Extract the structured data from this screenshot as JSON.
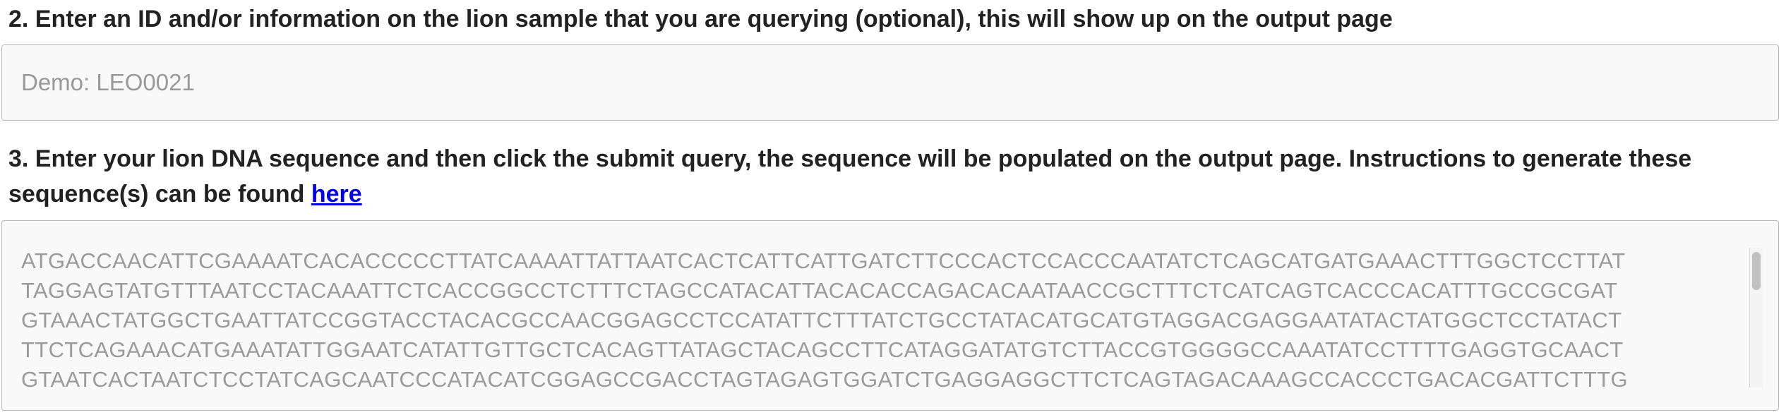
{
  "step2": {
    "label": "2. Enter an ID and/or information on the lion sample that you are querying (optional), this will show up on the output page",
    "input_placeholder": "Demo: LEO0021",
    "input_value": ""
  },
  "step3": {
    "label_line1": "3. Enter your lion DNA sequence and then click the submit query, the sequence will be populated on the output page. Instructions to generate these",
    "label_line2_prefix": "sequence(s) can be found ",
    "link_text": "here",
    "sequence_placeholder_lines": [
      "ATGACCAACATTCGAAAATCACACCCCCTTATCAAAATTATTAATCACTCATTCATTGATCTTCCCACTCCACCCAATATCTCAGCATGATGAAACTTTGGCTCCTTAT",
      "TAGGAGTATGTTTAATCCTACAAATTCTCACCGGCCTCTTTCTAGCCATACATTACACACCAGACACAATAACCGCTTTCTCATCAGTCACCCACATTTGCCGCGAT",
      "GTAAACTATGGCTGAATTATCCGGTACCTACACGCCAACGGAGCCTCCATATTCTTTATCTGCCTATACATGCATGTAGGACGAGGAATATACTATGGCTCCTATACT",
      "TTCTCAGAAACATGAAATATTGGAATCATATTGTTGCTCACAGTTATAGCTACAGCCTTCATAGGATATGTCTTACCGTGGGGCCAAATATCCTTTTGAGGTGCAACT",
      "GTAATCACTAATCTCCTATCAGCAATCCCATACATCGGAGCCGACCTAGTAGAGTGGATCTGAGGAGGCTTCTCAGTAGACAAAGCCACCCTGACACGATTCTTTG"
    ]
  },
  "colors": {
    "label_text": "#222222",
    "placeholder_text": "#999999",
    "field_border": "#b9b9b9",
    "field_background": "#f9f9f9",
    "link": "#0000ee"
  }
}
